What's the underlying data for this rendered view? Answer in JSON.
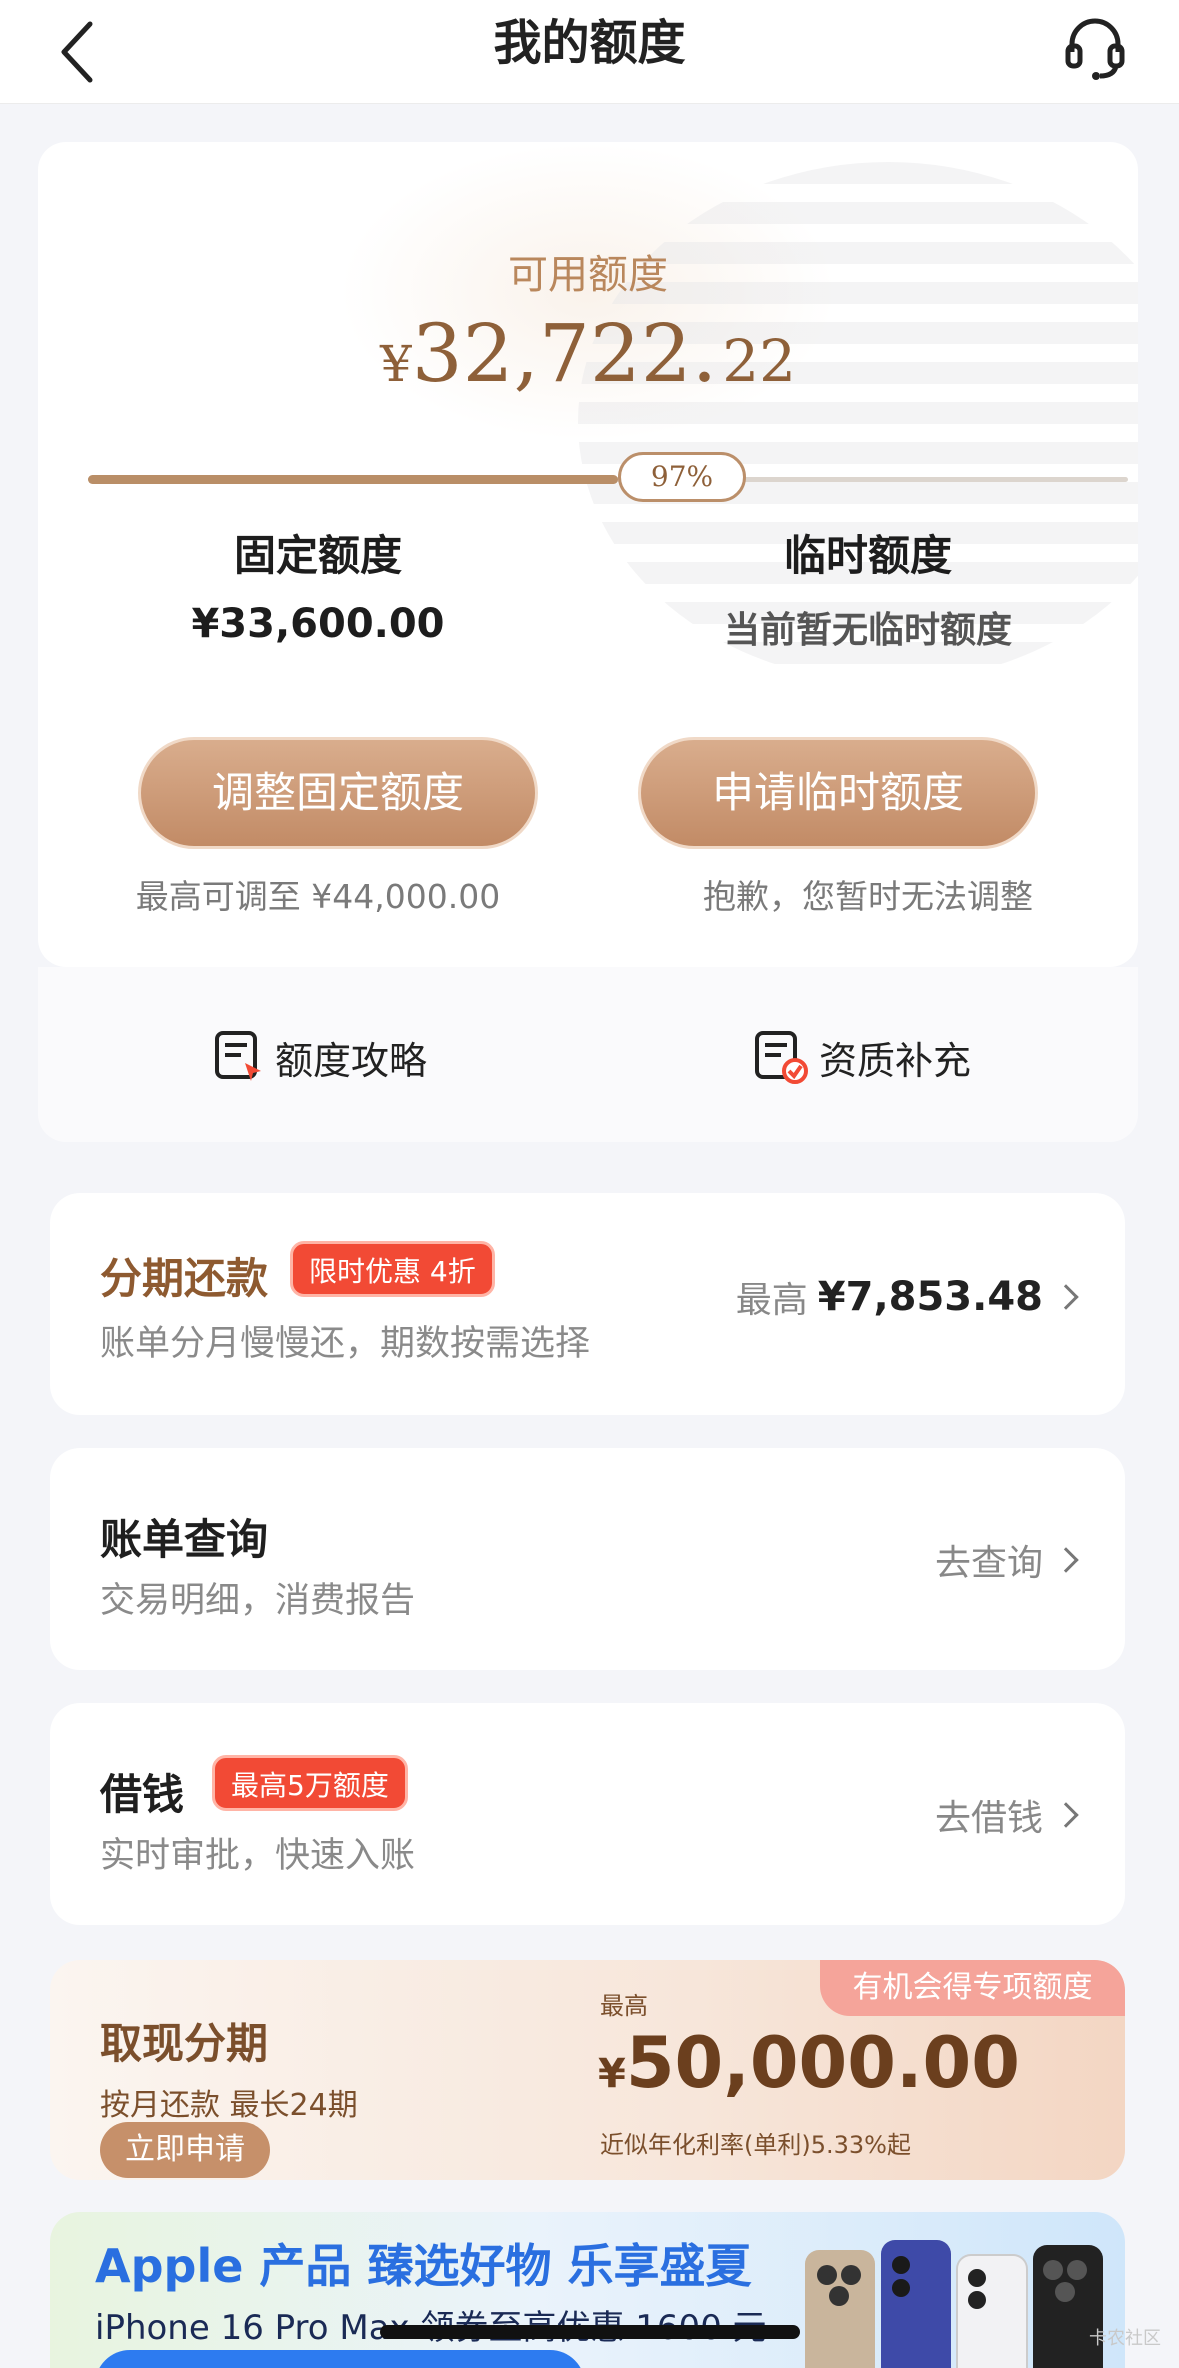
{
  "nav": {
    "title": "我的额度"
  },
  "credit": {
    "available_label": "可用额度",
    "currency": "¥",
    "available_int": "32,722.",
    "available_dec": "22",
    "usage_percent": 97,
    "usage_label": "97%",
    "fixed_title": "固定额度",
    "fixed_value": "¥33,600.00",
    "temp_title": "临时额度",
    "temp_value": "当前暂无临时额度",
    "adjust_button": "调整固定额度",
    "apply_temp_button": "申请临时额度",
    "adjust_note": "最高可调至 ¥44,000.00",
    "temp_note": "抱歉，您暂时无法调整"
  },
  "tools": [
    {
      "label": "额度攻略"
    },
    {
      "label": "资质补充"
    }
  ],
  "installment": {
    "title": "分期还款",
    "tag": "限时优惠 4折",
    "subtitle": "账单分月慢慢还，期数按需选择",
    "right_prefix": "最高",
    "right_amount": "¥7,853.48"
  },
  "bill": {
    "title": "账单查询",
    "subtitle": "交易明细，消费报告",
    "action": "去查询"
  },
  "borrow": {
    "title": "借钱",
    "tag": "最高5万额度",
    "subtitle": "实时审批，快速入账",
    "action": "去借钱"
  },
  "cash": {
    "tag": "有机会得专项额度",
    "title": "取现分期",
    "subtitle": "按月还款 最长24期",
    "button": "立即申请",
    "max_label": "最高",
    "currency": "¥",
    "amount": "50,000.00",
    "rate": "近似年化利率(单利)5.33%起"
  },
  "promo": {
    "title": "Apple 产品 臻选好物 乐享盛夏",
    "subtitle": "iPhone 16 Pro Max 领券至高优惠 1600 元"
  },
  "watermark": "卡农社区",
  "colors": {
    "accent_brown": "#b9875c",
    "button_brown": "#c28b66",
    "tag_red": "#f24a35",
    "promo_blue": "#2a6fe0"
  }
}
